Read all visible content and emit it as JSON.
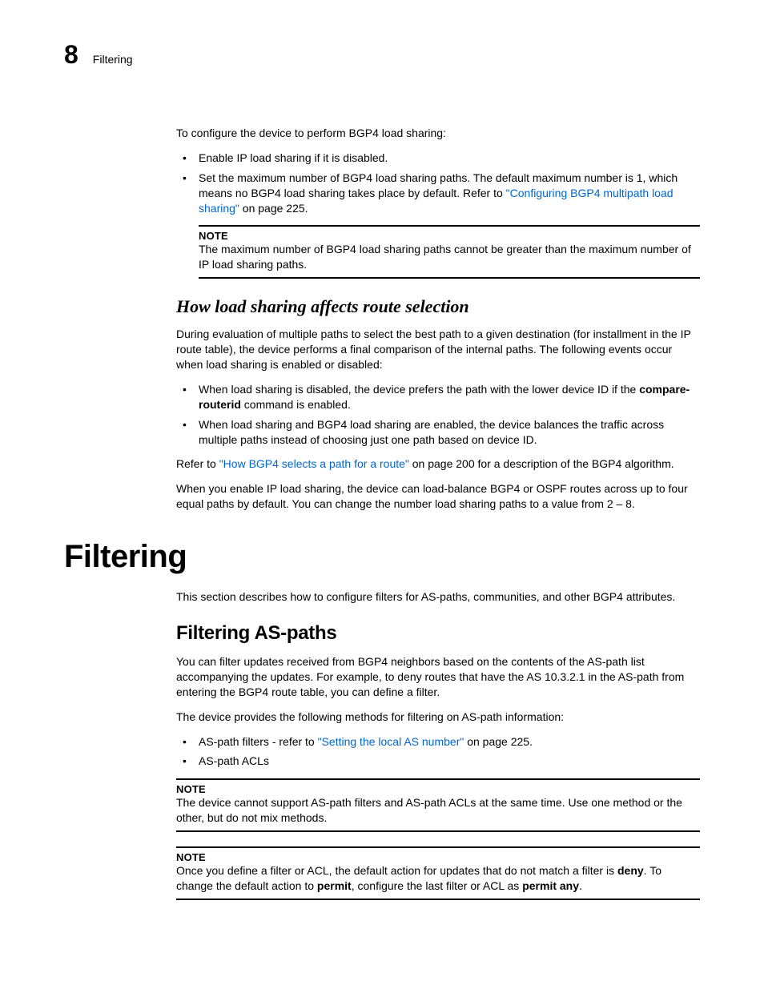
{
  "header": {
    "chapter_number": "8",
    "chapter_name": "Filtering"
  },
  "intro": {
    "p1": "To configure the device to perform BGP4 load sharing:",
    "li1": "Enable IP load sharing if it is disabled.",
    "li2_a": "Set the maximum number of BGP4 load sharing paths. The default maximum number is 1, which means no BGP4 load sharing takes place by default. Refer to ",
    "li2_link": "\"Configuring BGP4 multipath load sharing\"",
    "li2_b": " on page 225.",
    "note_label": "NOTE",
    "note_text": "The maximum number of BGP4 load sharing paths cannot be greater than the maximum number of IP load sharing paths."
  },
  "sec1": {
    "title": "How load sharing affects route selection",
    "p1": "During evaluation of multiple paths to select the best path to a given destination (for installment in the IP route table), the device performs a final comparison of the internal paths. The following events occur when load sharing is enabled or disabled:",
    "li1_a": "When load sharing is disabled, the device prefers the path with the lower device ID if the ",
    "li1_b": "compare-routerid",
    "li1_c": " command is enabled.",
    "li2": "When load sharing and BGP4 load sharing are enabled, the device balances the traffic across multiple paths instead of choosing just one path based on device ID.",
    "p2_a": "Refer to ",
    "p2_link": "\"How BGP4 selects a path for a route\"",
    "p2_b": " on page 200 for a description of the BGP4 algorithm.",
    "p3": "When you enable IP load sharing, the device can load-balance BGP4 or OSPF routes across up to four equal paths by default. You can change the number load sharing paths to a value from 2 – 8."
  },
  "sec2": {
    "title": "Filtering",
    "p1": "This section describes how to configure filters for AS-paths, communities, and other BGP4 attributes."
  },
  "sec3": {
    "title": "Filtering AS-paths",
    "p1": "You can filter updates received from BGP4 neighbors based on the contents of the AS-path list accompanying the updates. For example, to deny routes that have the AS 10.3.2.1 in the AS-path from entering the BGP4 route table, you can define a filter.",
    "p2": "The device provides the following methods for filtering on AS-path information:",
    "li1_a": "AS-path filters - refer to ",
    "li1_link": "\"Setting the local AS number\"",
    "li1_b": " on page 225.",
    "li2": "AS-path ACLs",
    "note1_label": "NOTE",
    "note1_text": "The device cannot support AS-path filters and AS-path ACLs at the same time. Use one method or the other, but do not mix methods.",
    "note2_label": "NOTE",
    "note2_a": "Once you define a filter or ACL, the default action for updates that do not match a filter is ",
    "note2_b": "deny",
    "note2_c": ". To change the default action to ",
    "note2_d": "permit",
    "note2_e": ", configure the last filter or ACL as ",
    "note2_f": "permit any",
    "note2_g": "."
  }
}
